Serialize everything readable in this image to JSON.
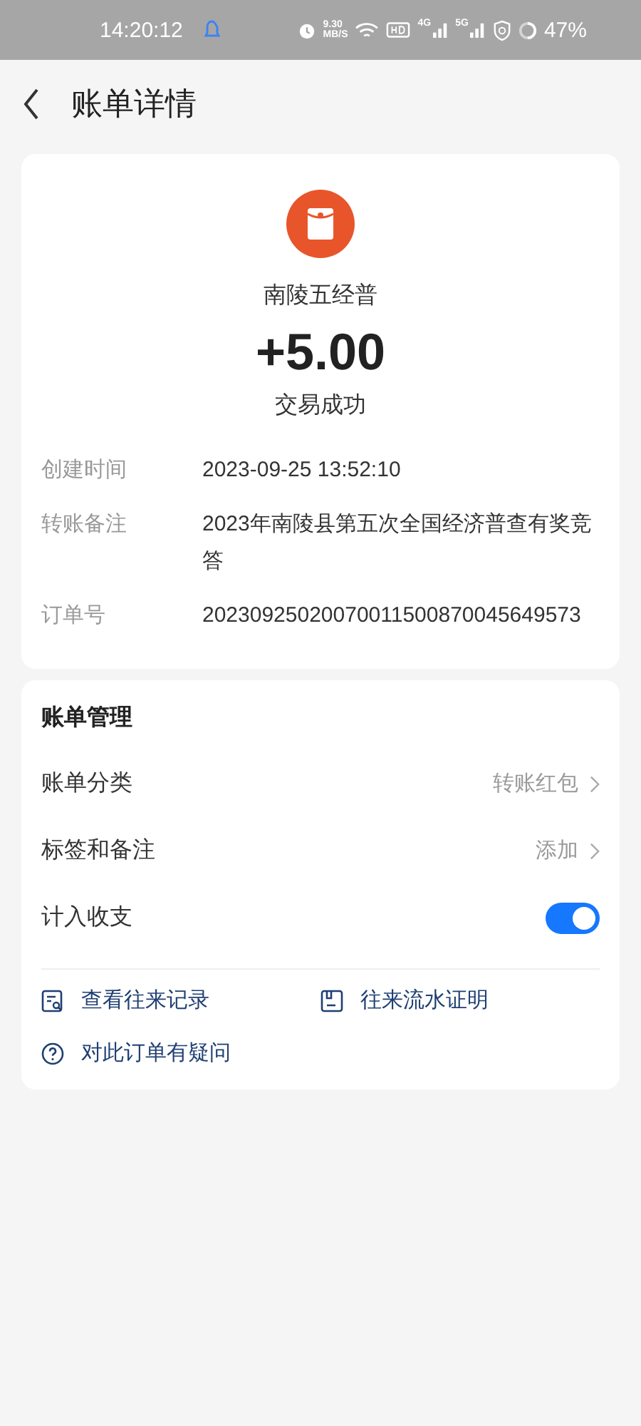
{
  "status_bar": {
    "time": "14:20:12",
    "speed_value": "9.30",
    "speed_unit": "MB/S",
    "network_1": "4G",
    "network_2": "5G",
    "battery": "47%"
  },
  "header": {
    "title": "账单详情"
  },
  "summary": {
    "payee": "南陵五经普",
    "amount": "+5.00",
    "status": "交易成功",
    "details": [
      {
        "label": "创建时间",
        "value": "2023-09-25 13:52:10"
      },
      {
        "label": "转账备注",
        "value": "2023年南陵县第五次全国经济普查有奖竞答"
      },
      {
        "label": "订单号",
        "value": "20230925020070011500870045649573"
      }
    ]
  },
  "management": {
    "title": "账单管理",
    "rows": [
      {
        "kind": "link",
        "label": "账单分类",
        "value": "转账红包"
      },
      {
        "kind": "link",
        "label": "标签和备注",
        "value": "添加"
      },
      {
        "kind": "toggle",
        "label": "计入收支",
        "on": true
      }
    ],
    "actions": [
      {
        "kind": "records",
        "label": "查看往来记录"
      },
      {
        "kind": "statement",
        "label": "往来流水证明"
      },
      {
        "kind": "question",
        "label": "对此订单有疑问"
      }
    ]
  }
}
